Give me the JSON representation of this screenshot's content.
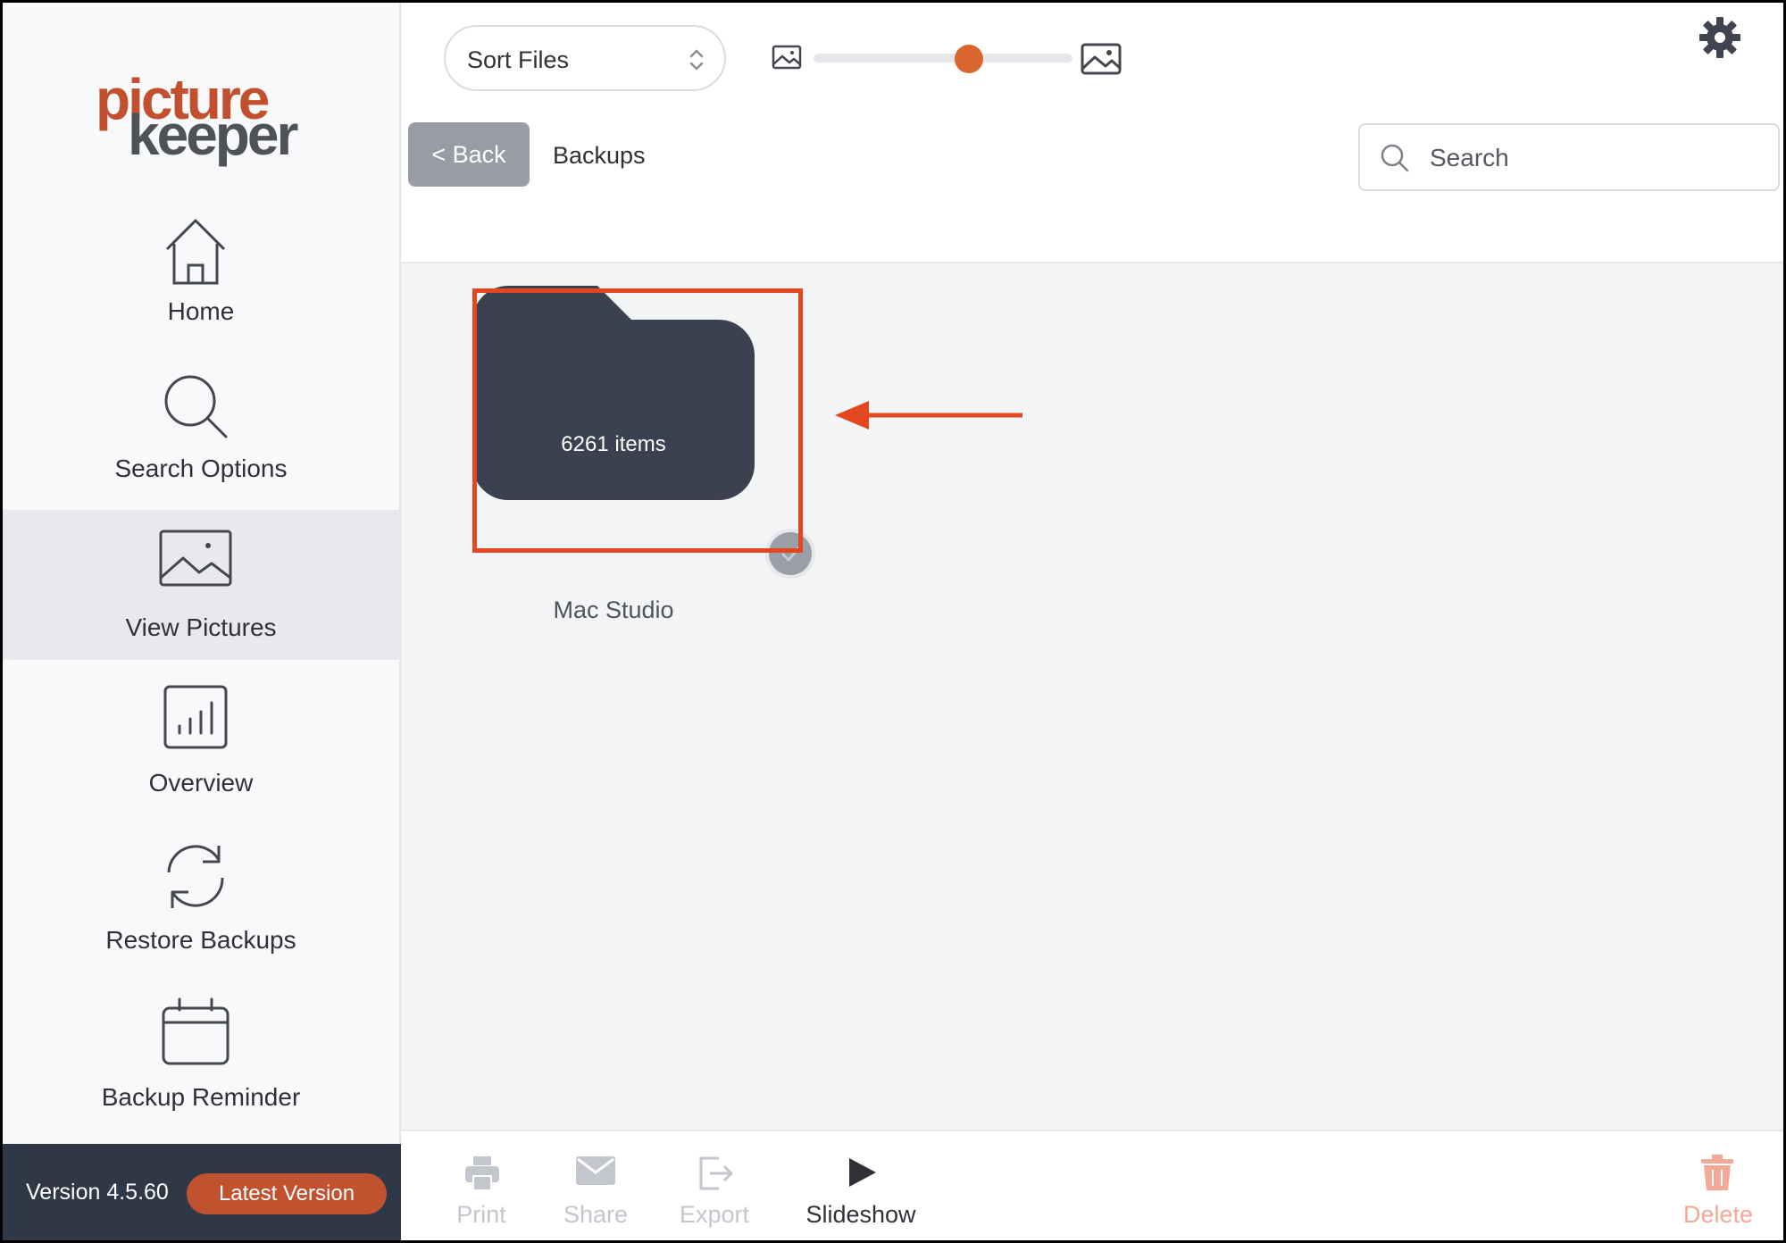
{
  "logo": {
    "line1": "picture",
    "line2": "keeper"
  },
  "sidebar": {
    "items": [
      {
        "label": "Home",
        "icon": "home-icon",
        "active": false
      },
      {
        "label": "Search Options",
        "icon": "search-icon",
        "active": false
      },
      {
        "label": "View Pictures",
        "icon": "image-icon",
        "active": true
      },
      {
        "label": "Overview",
        "icon": "chart-icon",
        "active": false
      },
      {
        "label": "Restore Backups",
        "icon": "refresh-icon",
        "active": false
      },
      {
        "label": "Backup Reminder",
        "icon": "calendar-icon",
        "active": false
      }
    ],
    "version": "Version 4.5.60",
    "latest_label": "Latest Version"
  },
  "toolbar": {
    "sort_label": "Sort Files",
    "thumbnail_size_level": 0.6,
    "back_label": "< Back",
    "breadcrumb": "Backups",
    "search_placeholder": "Search"
  },
  "content": {
    "folders": [
      {
        "name": "Mac Studio",
        "count": "6261 items"
      }
    ]
  },
  "actions": {
    "print": "Print",
    "share": "Share",
    "export": "Export",
    "slideshow": "Slideshow",
    "delete": "Delete"
  },
  "colors": {
    "brand_orange": "#c1522f",
    "highlight_red": "#e2471f",
    "folder": "#3b4150",
    "sidebar_footer": "#2f3847"
  }
}
